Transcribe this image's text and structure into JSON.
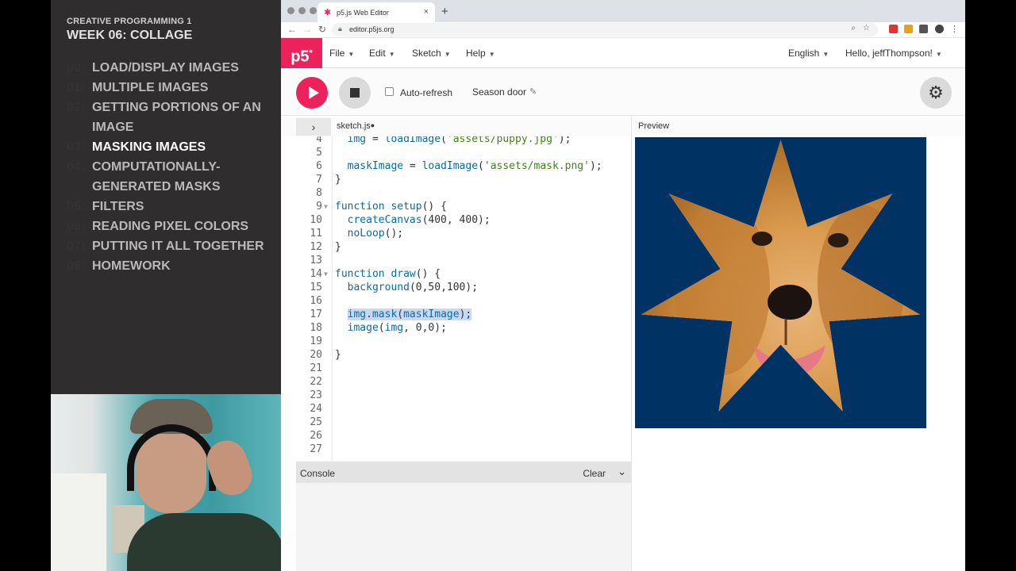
{
  "slide": {
    "course": "CREATIVE PROGRAMMING 1",
    "week": "WEEK 06: COLLAGE",
    "items": [
      {
        "num": "00:",
        "text": "LOAD/DISPLAY IMAGES"
      },
      {
        "num": "01:",
        "text": "MULTIPLE IMAGES"
      },
      {
        "num": "02:",
        "text": "GETTING PORTIONS OF AN IMAGE"
      },
      {
        "num": "03:",
        "text": "MASKING IMAGES"
      },
      {
        "num": "04:",
        "text": "COMPUTATIONALLY-GENERATED MASKS"
      },
      {
        "num": "05:",
        "text": "FILTERS"
      },
      {
        "num": "06:",
        "text": "READING PIXEL COLORS"
      },
      {
        "num": "07:",
        "text": "PUTTING IT ALL TOGETHER"
      },
      {
        "num": "08:",
        "text": "HOMEWORK"
      }
    ],
    "active_index": 3
  },
  "browser": {
    "tab_title": "p5.js Web Editor",
    "tab_close": "×",
    "new_tab": "+",
    "url": "editor.p5js.org"
  },
  "p5nav": {
    "logo": "p5",
    "logo_sup": "*",
    "menus": [
      "File",
      "Edit",
      "Sketch",
      "Help"
    ],
    "language": "English",
    "user": "Hello, jeffThompson!"
  },
  "toolbar": {
    "auto_refresh_label": "Auto-refresh",
    "auto_refresh_checked": false,
    "sketch_name": "Season door"
  },
  "editor": {
    "filename": "sketch.js",
    "dirty_marker": "●",
    "lines": [
      {
        "n": "4",
        "code": "  img = loadImage('assets/puppy.jpg');"
      },
      {
        "n": "5",
        "code": ""
      },
      {
        "n": "6",
        "code": "  maskImage = loadImage('assets/mask.png');"
      },
      {
        "n": "7",
        "code": "}"
      },
      {
        "n": "8",
        "code": ""
      },
      {
        "n": "9",
        "code": "function setup() {",
        "fold": true
      },
      {
        "n": "10",
        "code": "  createCanvas(400, 400);"
      },
      {
        "n": "11",
        "code": "  noLoop();"
      },
      {
        "n": "12",
        "code": "}"
      },
      {
        "n": "13",
        "code": ""
      },
      {
        "n": "14",
        "code": "function draw() {",
        "fold": true
      },
      {
        "n": "15",
        "code": "  background(0,50,100);"
      },
      {
        "n": "16",
        "code": ""
      },
      {
        "n": "17",
        "code": "  img.mask(maskImage);",
        "highlight": true
      },
      {
        "n": "18",
        "code": "  image(img, 0,0);"
      },
      {
        "n": "19",
        "code": ""
      },
      {
        "n": "20",
        "code": "}"
      },
      {
        "n": "21",
        "code": ""
      },
      {
        "n": "22",
        "code": ""
      },
      {
        "n": "23",
        "code": ""
      },
      {
        "n": "24",
        "code": ""
      },
      {
        "n": "25",
        "code": ""
      },
      {
        "n": "26",
        "code": ""
      },
      {
        "n": "27",
        "code": ""
      }
    ]
  },
  "console": {
    "title": "Console",
    "clear_label": "Clear"
  },
  "preview": {
    "title": "Preview",
    "background_color": "#003264"
  },
  "colors": {
    "accent": "#ed225d",
    "slide_bg": "#2f2d2d"
  }
}
